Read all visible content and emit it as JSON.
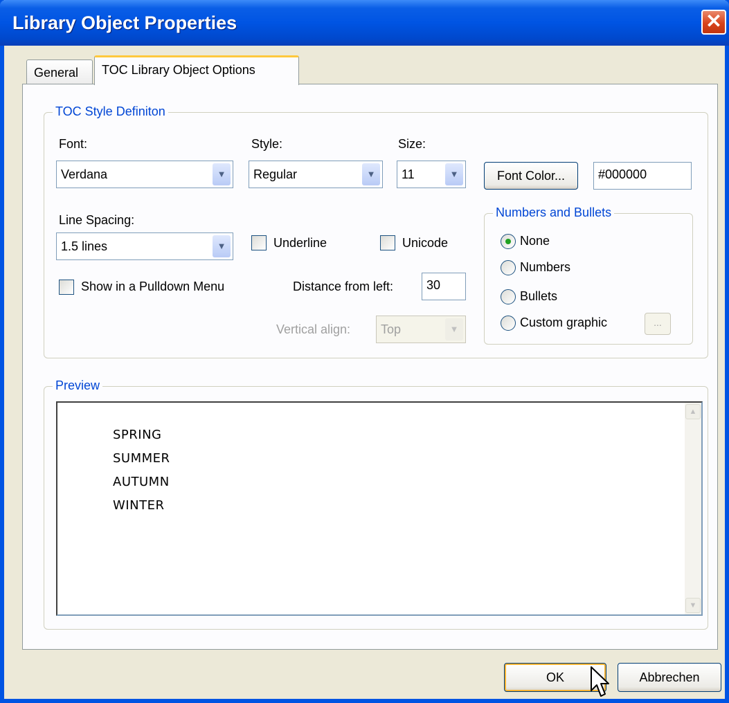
{
  "window": {
    "title": "Library Object Properties",
    "close_glyph": "✕"
  },
  "tabs": [
    {
      "label": "General",
      "active": false
    },
    {
      "label": "TOC Library Object Options",
      "active": true
    }
  ],
  "toc_style": {
    "legend": "TOC Style Definiton",
    "font_label": "Font:",
    "font_value": "Verdana",
    "style_label": "Style:",
    "style_value": "Regular",
    "size_label": "Size:",
    "size_value": "11",
    "font_color_button": "Font Color...",
    "font_color_value": "#000000",
    "line_spacing_label": "Line Spacing:",
    "line_spacing_value": "1.5 lines",
    "underline_label": "Underline",
    "underline_checked": false,
    "unicode_label": "Unicode",
    "unicode_checked": false,
    "pulldown_label": "Show in a Pulldown Menu",
    "pulldown_checked": false,
    "distance_label": "Distance from left:",
    "distance_value": "30",
    "vertical_align_label": "Vertical align:",
    "vertical_align_value": "Top",
    "vertical_align_enabled": false
  },
  "numbers_bullets": {
    "legend": "Numbers and Bullets",
    "options": [
      {
        "label": "None",
        "selected": true
      },
      {
        "label": "Numbers",
        "selected": false
      },
      {
        "label": "Bullets",
        "selected": false
      },
      {
        "label": "Custom graphic",
        "selected": false
      }
    ],
    "browse_button": "..."
  },
  "preview": {
    "legend": "Preview",
    "lines": [
      "SPRING",
      "SUMMER",
      "AUTUMN",
      "WINTER"
    ]
  },
  "footer": {
    "ok_label": "OK",
    "cancel_label": "Abbrechen"
  },
  "colors": {
    "titlebar": "#0054e3",
    "legend_text": "#0046d5",
    "dialog_bg": "#ece9d8",
    "default_button_ring": "#f8b331"
  },
  "icons": {
    "dropdown_arrow": "chevron-down-icon",
    "scroll_up": "scroll-up-arrow-icon",
    "scroll_down": "scroll-down-arrow-icon",
    "cursor": "mouse-pointer-icon"
  }
}
